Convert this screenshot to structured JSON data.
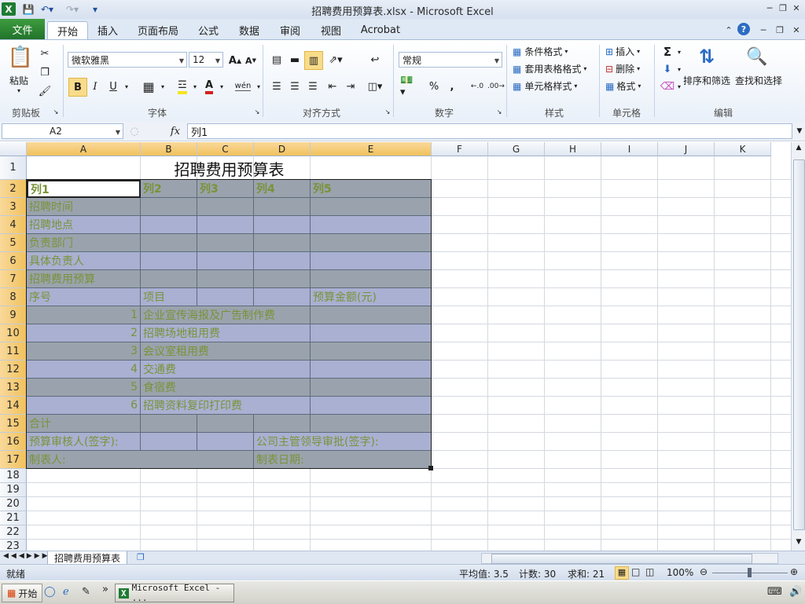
{
  "window": {
    "title": "招聘费用预算表.xlsx - Microsoft Excel"
  },
  "ribbon_tabs": [
    "开始",
    "插入",
    "页面布局",
    "公式",
    "数据",
    "审阅",
    "视图",
    "Acrobat"
  ],
  "file_tab": "文件",
  "clipboard": {
    "paste": "粘贴",
    "group": "剪贴板"
  },
  "font": {
    "name": "微软雅黑",
    "size": "12",
    "group": "字体",
    "bold": "B",
    "italic": "I",
    "underline": "U",
    "grow": "A",
    "shrink": "A",
    "phonetic": "wén"
  },
  "align": {
    "group": "对齐方式"
  },
  "number": {
    "format": "常规",
    "group": "数字",
    "percent": "%",
    "comma": ",",
    "inc": ".0\n.00",
    "dec": ".00\n→.0"
  },
  "styles": {
    "cond": "条件格式",
    "table": "套用表格格式",
    "cell": "单元格样式",
    "group": "样式"
  },
  "cells": {
    "insert": "插入",
    "delete": "删除",
    "format": "格式",
    "group": "单元格"
  },
  "editing": {
    "sort": "排序和筛选",
    "find": "查找和选择",
    "group": "编辑",
    "sum": "Σ"
  },
  "formula_bar": {
    "name_box": "A2",
    "fx": "fx",
    "value": "列1"
  },
  "columns": [
    "A",
    "B",
    "C",
    "D",
    "E",
    "F",
    "G",
    "H",
    "I",
    "J",
    "K"
  ],
  "rows": [
    "1",
    "2",
    "3",
    "4",
    "5",
    "6",
    "7",
    "8",
    "9",
    "10",
    "11",
    "12",
    "13",
    "14",
    "15",
    "16",
    "17",
    "18",
    "19",
    "20",
    "21",
    "22",
    "23"
  ],
  "sheet": {
    "title": "招聘费用预算表",
    "header": [
      "列1",
      "列2",
      "列3",
      "列4",
      "列5"
    ],
    "labels": [
      "招聘时间",
      "招聘地点",
      "负责部门",
      "具体负责人",
      "招聘费用预算"
    ],
    "r8": {
      "a": "序号",
      "b": "项目",
      "e": "预算金额(元)"
    },
    "items": [
      {
        "no": "1",
        "name": "企业宣传海报及广告制作费"
      },
      {
        "no": "2",
        "name": "招聘场地租用费"
      },
      {
        "no": "3",
        "name": "会议室租用费"
      },
      {
        "no": "4",
        "name": "交通费"
      },
      {
        "no": "5",
        "name": "食宿费"
      },
      {
        "no": "6",
        "name": "招聘资料复印打印费"
      }
    ],
    "total": "合计",
    "r16": {
      "a": "预算审核人(签字):",
      "d": "公司主管领导审批(签字):"
    },
    "r17": {
      "a": "制表人:",
      "d": "制表日期:"
    }
  },
  "sheet_tab": "招聘费用预算表",
  "status": {
    "ready": "就绪",
    "avg": "平均值: 3.5",
    "count": "计数: 30",
    "sum": "求和: 21",
    "zoom": "100%"
  },
  "taskbar": {
    "start": "开始",
    "window": "Microsoft Excel - ..."
  },
  "colors": {
    "band_dark": "#9aa3ad",
    "band_light": "#a9b0d1",
    "text": "#7a9238",
    "header_sel": "#f1c15d"
  }
}
